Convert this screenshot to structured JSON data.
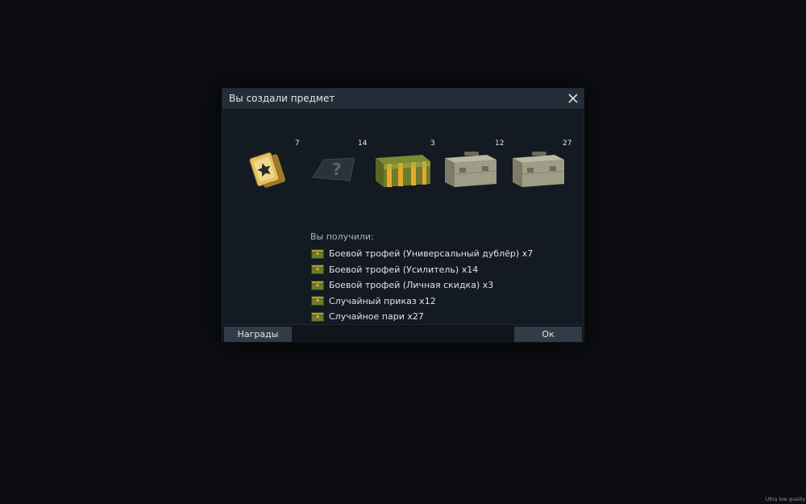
{
  "dialog": {
    "title": "Вы создали предмет",
    "close_icon": "close-icon",
    "items": [
      {
        "icon": "star-cards-icon",
        "count": "7"
      },
      {
        "icon": "unknown-item-icon",
        "count": "14"
      },
      {
        "icon": "golden-chest-icon",
        "count": "3"
      },
      {
        "icon": "ammo-box-icon",
        "count": "12"
      },
      {
        "icon": "ammo-box-icon",
        "count": "27"
      }
    ],
    "received_label": "Вы получили:",
    "rewards": [
      {
        "icon": "trophy-chest-icon",
        "text": "Боевой трофей (Универсальный дублёр) x7"
      },
      {
        "icon": "trophy-chest-icon",
        "text": "Боевой трофей (Усилитель) x14"
      },
      {
        "icon": "trophy-chest-icon",
        "text": "Боевой трофей (Личная скидка) x3"
      },
      {
        "icon": "trophy-chest-icon",
        "text": "Случайный приказ x12"
      },
      {
        "icon": "trophy-chest-icon",
        "text": "Случайное пари x27"
      }
    ],
    "buttons": {
      "rewards_label": "Награды",
      "ok_label": "Ок"
    }
  },
  "status": {
    "quality_label": "Ultra low quality"
  },
  "colors": {
    "background": "#0b0d10",
    "dialog": "#141a21",
    "titlebar": "#252e38",
    "button": "#313c48"
  }
}
